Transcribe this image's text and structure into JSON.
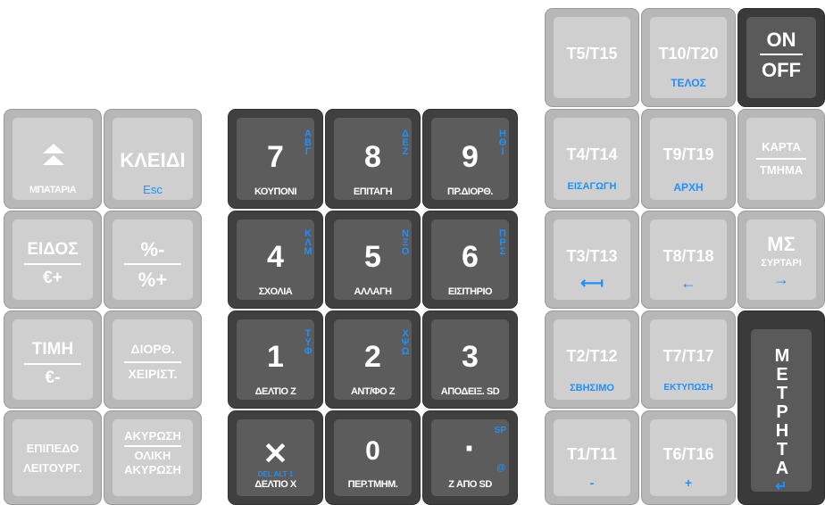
{
  "keys": {
    "battery": {
      "label": "ΜΠΑΤΑΡΙΑ"
    },
    "key_esc": {
      "title": "ΚΛΕΙΔΙ",
      "sub": "Esc"
    },
    "kind": {
      "top": "ΕΙΔΟΣ",
      "bottom": "€+"
    },
    "percent": {
      "top": "%-",
      "bottom": "%+"
    },
    "price": {
      "top": "ΤΙΜΗ",
      "bottom": "€-"
    },
    "correction": {
      "top": "ΔΙΟΡΘ.",
      "bottom": "ΧΕΙΡΙΣΤ."
    },
    "level": {
      "line1": "ΕΠΙΠΕΔΟ",
      "line2": "ΛΕΙΤΟΥΡΓ."
    },
    "void": {
      "line1": "ΑΚΥΡΩΣΗ",
      "line2": "ΟΛΙΚΗ",
      "line3": "ΑΚΥΡΩΣΗ"
    },
    "k7": {
      "digit": "7",
      "sub": "ΚΟΥΠΟΝΙ",
      "letters": "ΑΒΓ"
    },
    "k8": {
      "digit": "8",
      "sub": "ΕΠΙΤΑΓΗ",
      "letters": "ΔΕΖ"
    },
    "k9": {
      "digit": "9",
      "sub": "ΠΡ.ΔΙΟΡΘ.",
      "letters": "ΗΘΙ"
    },
    "k4": {
      "digit": "4",
      "sub": "ΣΧΟΛΙΑ",
      "letters": "ΚΛΜ"
    },
    "k5": {
      "digit": "5",
      "sub": "ΑΛΛΑΓΗ",
      "letters": "ΝΞΟ"
    },
    "k6": {
      "digit": "6",
      "sub": "ΕΙΣΙΤΗΡΙΟ",
      "letters": "ΠΡΣ"
    },
    "k1": {
      "digit": "1",
      "sub": "ΔΕΛΤΙΟ Z",
      "letters": "ΤΥΦ"
    },
    "k2": {
      "digit": "2",
      "sub": "ΑΝΤ/ΦΟ Z",
      "letters": "ΧΨΩ"
    },
    "k3": {
      "digit": "3",
      "sub": "ΑΠΟΔΕΙΞ. SD"
    },
    "kx": {
      "symbol": "✕",
      "sub": "ΔΕΛΤΙΟ X",
      "note": "DEL ALT 1"
    },
    "k0": {
      "digit": "0",
      "sub": "ΠΕΡ.ΤΜΗΜ."
    },
    "kdot": {
      "symbol": "·",
      "sub": "Z ΑΠΟ SD",
      "top_note": "SP",
      "bottom_note": "@"
    },
    "t5": {
      "label": "T5/T15"
    },
    "t10": {
      "label": "T10/T20",
      "sub": "ΤΕΛΟΣ"
    },
    "onoff": {
      "top": "ON",
      "bottom": "OFF"
    },
    "t4": {
      "label": "T4/T14",
      "sub": "ΕΙΣΑΓΩΓΗ"
    },
    "t9": {
      "label": "T9/T19",
      "sub": "ΑΡΧΗ"
    },
    "card": {
      "top": "ΚΑΡΤΑ",
      "bottom": "ΤΜΗΜΑ"
    },
    "t3": {
      "label": "T3/T13",
      "arrow": "⟻"
    },
    "t8": {
      "label": "T8/T18",
      "arrow": "←"
    },
    "ms": {
      "label": "ΜΣ",
      "sub": "ΣΥΡΤΑΡΙ",
      "arrow": "→"
    },
    "t2": {
      "label": "T2/T12",
      "sub": "ΣΒΗΣΙΜΟ"
    },
    "t7": {
      "label": "T7/T17",
      "sub": "ΕΚΤΥΠΩΣΗ"
    },
    "cash": {
      "label": "ΜΕΤΡΗΤΑ",
      "enter": "↵"
    },
    "t1": {
      "label": "T1/T11",
      "sub": "-"
    },
    "t6": {
      "label": "T6/T16",
      "sub": "+"
    }
  }
}
